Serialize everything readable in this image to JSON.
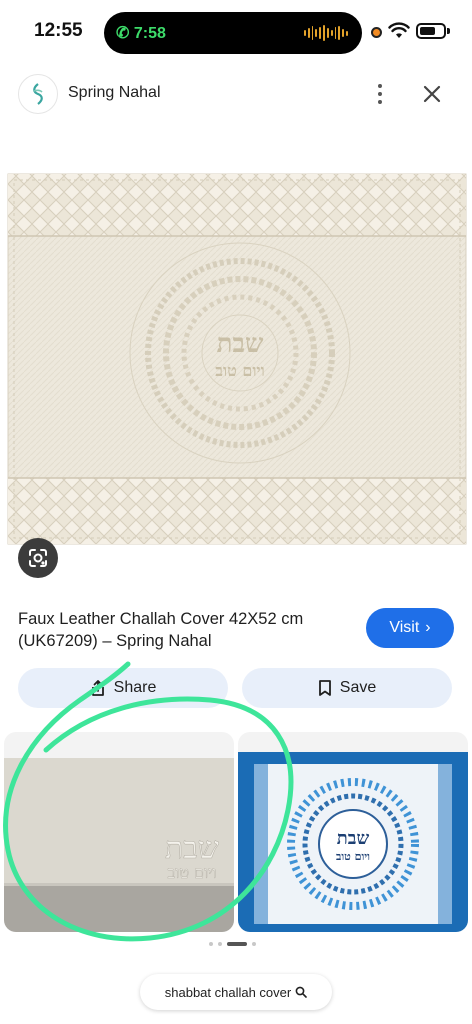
{
  "status_bar": {
    "time": "12:55",
    "call_timer": "7:58",
    "icons": [
      "phone-icon",
      "recording-dot",
      "wifi-icon",
      "battery-icon"
    ]
  },
  "header": {
    "site_name": "Spring Nahal",
    "logo_text": "Spring Nahal",
    "icons": [
      "more-vert-icon",
      "close-icon"
    ]
  },
  "product": {
    "image_center_text_1": "שבת",
    "image_center_text_2": "ויום טוב",
    "title": "Faux Leather Challah Cover 42X52 cm (UK67209) – Spring Nahal",
    "visit_label": "Visit",
    "share_label": "Share",
    "save_label": "Save"
  },
  "related": {
    "item1_text_1": "שבת",
    "item1_text_2": "ויום טוב",
    "item2_text_1": "שבת",
    "item2_text_2": "ויום טוב"
  },
  "search_chip": {
    "query": "shabbat challah cover"
  },
  "colors": {
    "accent": "#1f6fe8",
    "pill_bg": "#e8effa",
    "annotation_stroke": "#3ee59a",
    "cover_cream": "#ede8dc",
    "blue_cover": "#1b6cb5"
  }
}
